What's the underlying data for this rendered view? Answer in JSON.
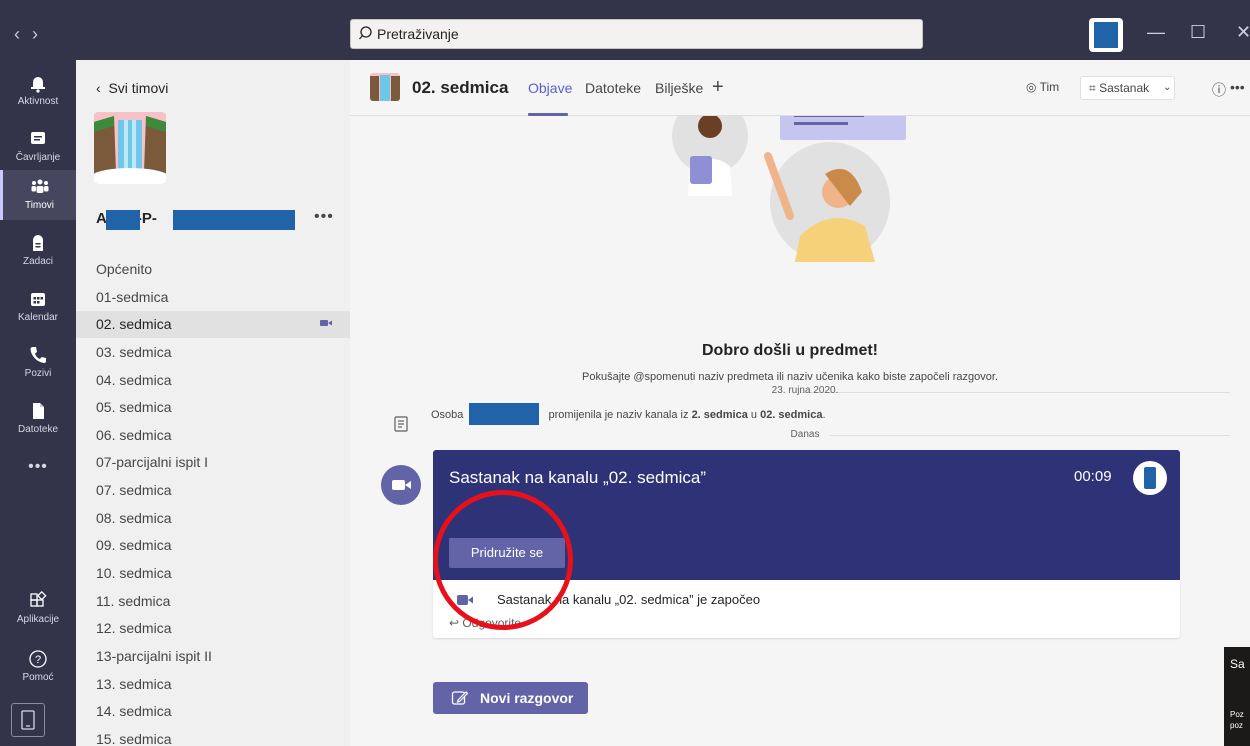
{
  "titlebar": {
    "search_placeholder": "Pretraživanje",
    "back_arrow": "‹",
    "forward_arrow": "›",
    "minimize": "—",
    "maximize": "☐",
    "close": "✕"
  },
  "rail": {
    "items": [
      {
        "label": "Aktivnost",
        "icon": "bell-icon"
      },
      {
        "label": "Čavrljanje",
        "icon": "chat-icon"
      },
      {
        "label": "Timovi",
        "icon": "teams-icon"
      },
      {
        "label": "Zadaci",
        "icon": "assignments-icon"
      },
      {
        "label": "Kalendar",
        "icon": "calendar-icon"
      },
      {
        "label": "Pozivi",
        "icon": "phone-icon"
      },
      {
        "label": "Datoteke",
        "icon": "files-icon"
      },
      {
        "label": "Aplikacije",
        "icon": "apps-icon"
      },
      {
        "label": "Pomoć",
        "icon": "help-icon"
      }
    ],
    "more": "•••"
  },
  "sidebar": {
    "back_label": "Svi timovi",
    "team_name_a": "A",
    "team_name_b": "-P-",
    "more": "•••",
    "channels": [
      "Općenito",
      "01-sedmica",
      "02. sedmica",
      "03. sedmica",
      "04. sedmica",
      "05. sedmica",
      "06. sedmica",
      "07-parcijalni ispit I",
      "07. sedmica",
      "08. sedmica",
      "09. sedmica",
      "10. sedmica",
      "11. sedmica",
      "12. sedmica",
      "13-parcijalni ispit II",
      "13. sedmica",
      "14. sedmica",
      "15. sedmica"
    ]
  },
  "header": {
    "channel_name": "02. sedmica",
    "tabs": [
      "Objave",
      "Datoteke",
      "Bilješke"
    ],
    "add_tab": "+",
    "team_button": "Tim",
    "meeting_button": "Sastanak",
    "info": "ⓘ",
    "more": "•••"
  },
  "welcome": {
    "title": "Dobro došli u predmet!",
    "subtitle": "Pokušajte @spomenuti naziv predmeta ili naziv učenika kako biste započeli razgovor."
  },
  "feed": {
    "date1": "23. rujna 2020.",
    "rename_prefix": "Osoba",
    "rename_middle": "promijenila je naziv kanala iz",
    "rename_from": "2. sedmica",
    "rename_u": "u",
    "rename_to": "02. sedmica",
    "rename_end": ".",
    "date2": "Danas"
  },
  "meeting": {
    "title": "Sastanak na kanalu „02. sedmica”",
    "duration": "00:09",
    "join_button": "Pridružite se",
    "started_text": "Sastanak na kanalu „02. sedmica” je započeo",
    "reply": "Odgovorite"
  },
  "compose": {
    "new_conversation": "Novi razgovor"
  },
  "toast": {
    "title": "Sa",
    "line1": "Poz",
    "line2": "poz"
  },
  "colors": {
    "titlebar": "#33344a",
    "accent": "#6264a7",
    "meeting_card": "#2e3277",
    "highlight_circle": "#e8101a",
    "redaction": "#2163a8"
  }
}
